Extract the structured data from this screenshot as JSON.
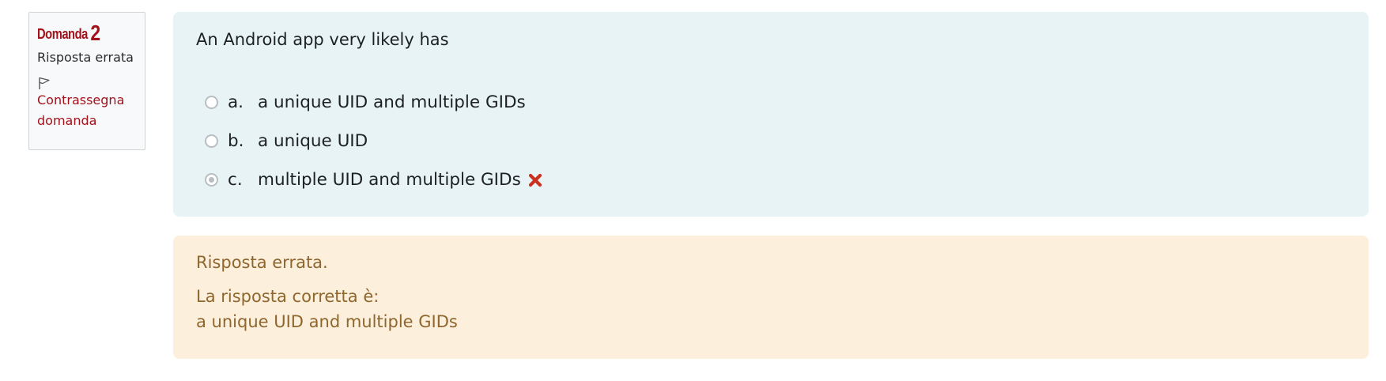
{
  "info": {
    "question_label": "Domanda",
    "question_number": "2",
    "state": "Risposta errata",
    "flag_icon": "flag-outline-icon",
    "flag_label": "Contrassegna domanda"
  },
  "question": {
    "text": "An Android app very likely has",
    "answers": [
      {
        "letter": "a.",
        "text": "a unique UID and multiple GIDs",
        "selected": false
      },
      {
        "letter": "b.",
        "text": "a unique UID",
        "selected": false
      },
      {
        "letter": "c.",
        "text": "multiple UID and multiple GIDs",
        "selected": true,
        "mark_icon": "incorrect-x-icon"
      }
    ]
  },
  "feedback": {
    "result": "Risposta errata.",
    "correct_intro": "La risposta corretta è:",
    "correct_answer": "a unique UID and multiple GIDs"
  },
  "colors": {
    "brand_red": "#a2121b",
    "question_bg": "#e7f3f5",
    "feedback_bg": "#fcefdc",
    "feedback_text": "#8e662e",
    "incorrect_icon": "#ca3120"
  }
}
